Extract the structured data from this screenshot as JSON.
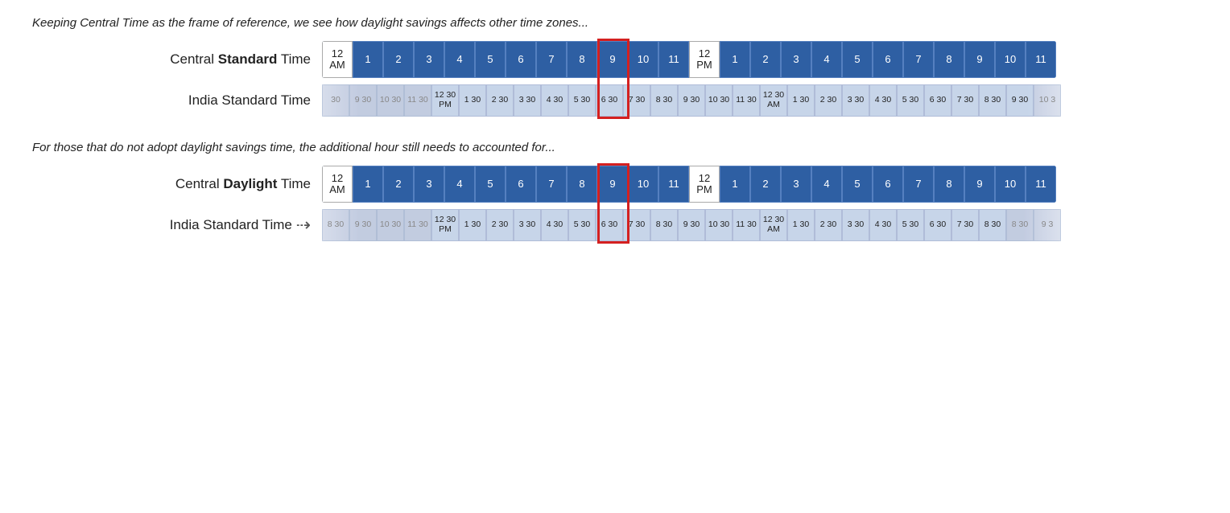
{
  "section1": {
    "caption": "Keeping Central Time as the frame of reference, we see how daylight savings affects other time zones...",
    "row1": {
      "label_prefix": "Central ",
      "label_bold": "Standard",
      "label_suffix": " Time",
      "cells": [
        "12\nAM",
        "1",
        "2",
        "3",
        "4",
        "5",
        "6",
        "7",
        "8",
        "9",
        "10",
        "11",
        "12\nPM",
        "1",
        "2",
        "3",
        "4",
        "5",
        "6",
        "7",
        "8",
        "9",
        "10",
        "11"
      ]
    },
    "row2": {
      "label": "India Standard Time",
      "cells_left_faded": [
        "30",
        "9 30",
        "10 30",
        "11 30"
      ],
      "cells_main": [
        "12 30\nPM",
        "1 30",
        "2 30",
        "3 30",
        "4 30",
        "5 30",
        "6 30",
        "7 30",
        "8 30",
        "9 30",
        "10 30",
        "11 30",
        "12 30\nAM",
        "1 30",
        "2 30",
        "3 30",
        "4 30",
        "5 30",
        "6 30",
        "7 30",
        "8 30",
        "9 30"
      ],
      "cells_right_faded": [
        "10 3"
      ]
    }
  },
  "section2": {
    "caption": "For those that do not adopt daylight savings time, the additional hour still needs to accounted for...",
    "row1": {
      "label_prefix": "Central ",
      "label_bold": "Daylight",
      "label_suffix": " Time",
      "cells": [
        "12\nAM",
        "1",
        "2",
        "3",
        "4",
        "5",
        "6",
        "7",
        "8",
        "9",
        "10",
        "11",
        "12\nPM",
        "1",
        "2",
        "3",
        "4",
        "5",
        "6",
        "7",
        "8",
        "9",
        "10",
        "11"
      ]
    },
    "row2": {
      "label": "India Standard Time",
      "has_arrow": true,
      "cells_left_faded": [
        "8 30",
        "9 30",
        "10 30",
        "11 30"
      ],
      "cells_main": [
        "12 30\nPM",
        "1 30",
        "2 30",
        "3 30",
        "4 30",
        "5 30",
        "6 30",
        "7 30",
        "8 30",
        "9 30",
        "10 30",
        "11 30",
        "12 30\nAM",
        "1 30",
        "2 30",
        "3 30",
        "4 30",
        "5 30",
        "6 30",
        "7 30",
        "8 30"
      ],
      "cells_right_faded": [
        "8 30",
        "9 3"
      ]
    }
  },
  "highlight": {
    "color": "#d42020"
  }
}
